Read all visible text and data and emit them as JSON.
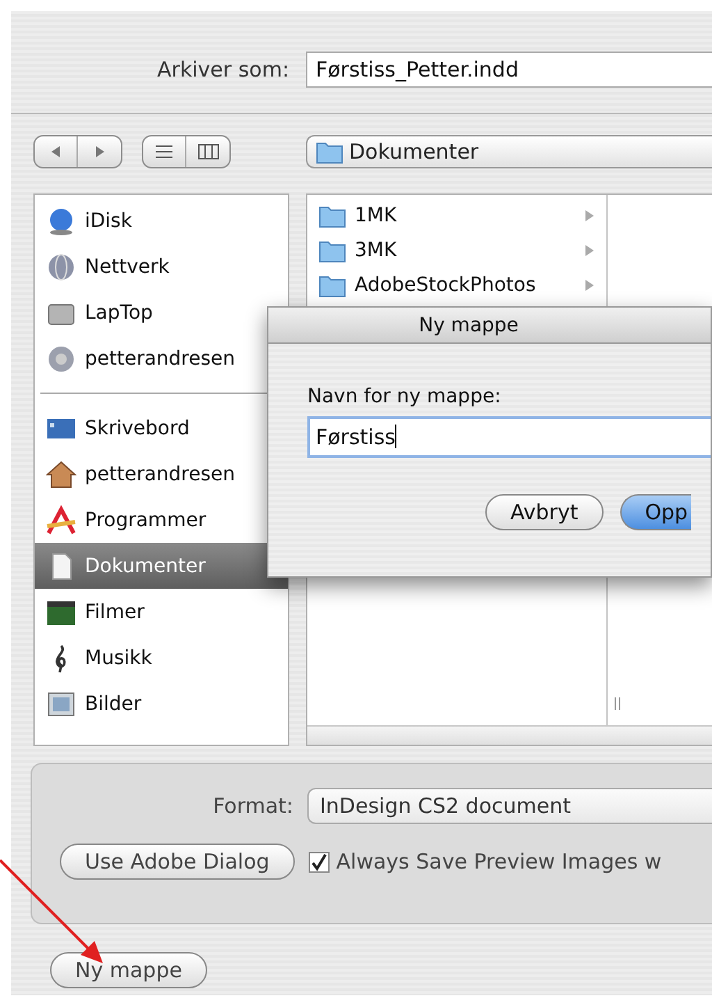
{
  "save_as": {
    "label": "Arkiver som:",
    "value": "Førstiss_Petter.indd"
  },
  "toolbar": {
    "location": "Dokumenter"
  },
  "sidebar": {
    "sections": [
      {
        "items": [
          {
            "label": "iDisk",
            "kind": "idisk",
            "selected": false
          },
          {
            "label": "Nettverk",
            "kind": "network",
            "selected": false
          },
          {
            "label": "LapTop",
            "kind": "drive",
            "selected": false
          },
          {
            "label": "petterandresen",
            "kind": "server",
            "selected": false
          }
        ]
      },
      {
        "items": [
          {
            "label": "Skrivebord",
            "kind": "desktop",
            "selected": false
          },
          {
            "label": "petterandresen",
            "kind": "home",
            "selected": false
          },
          {
            "label": "Programmer",
            "kind": "apps",
            "selected": false
          },
          {
            "label": "Dokumenter",
            "kind": "documents",
            "selected": true
          },
          {
            "label": "Filmer",
            "kind": "movies",
            "selected": false
          },
          {
            "label": "Musikk",
            "kind": "music",
            "selected": false
          },
          {
            "label": "Bilder",
            "kind": "pictures",
            "selected": false
          }
        ]
      }
    ]
  },
  "browser": {
    "columns": [
      {
        "items": [
          {
            "label": "1MK",
            "expandable": true
          },
          {
            "label": "3MK",
            "expandable": true
          },
          {
            "label": "AdobeStockPhotos",
            "expandable": true
          }
        ]
      }
    ]
  },
  "new_folder_dialog": {
    "title": "Ny mappe",
    "label": "Navn for ny mappe:",
    "value": "Førstiss",
    "buttons": [
      {
        "label": "Avbryt",
        "default": false
      },
      {
        "label": "Opp",
        "default": true
      }
    ]
  },
  "options": {
    "format_label": "Format:",
    "format_value": "InDesign CS2 document",
    "adobe_dialog_button": "Use Adobe Dialog",
    "preview_checkbox": {
      "label": "Always Save Preview Images w",
      "checked": true
    }
  },
  "new_folder_button": "Ny mappe"
}
